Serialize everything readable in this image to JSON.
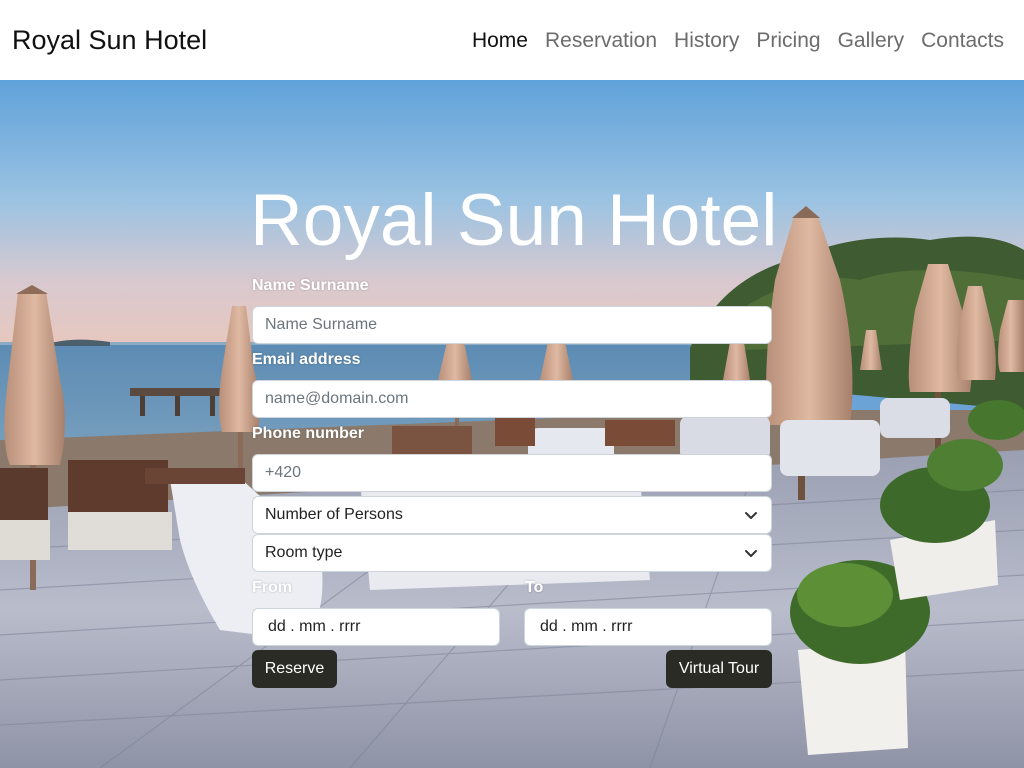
{
  "navbar": {
    "brand": "Royal Sun Hotel",
    "links": [
      "Home",
      "Reservation",
      "History",
      "Pricing",
      "Gallery",
      "Contacts"
    ],
    "active": "Home"
  },
  "hero": {
    "title": "Royal Sun Hotel",
    "background": "beach-terrace-photo"
  },
  "form": {
    "name_label": "Name Surname",
    "name_placeholder": "Name Surname",
    "email_label": "Email address",
    "email_placeholder": "name@domain.com",
    "phone_label": "Phone number",
    "phone_placeholder": "+420",
    "persons_select": "Number of Persons",
    "room_select": "Room type",
    "from_label": "From",
    "to_label": "To",
    "from_value": "dd . mm . rrrr",
    "to_value": "dd . mm . rrrr",
    "reserve_button": "Reserve",
    "tour_button": "Virtual Tour"
  },
  "colors": {
    "button_bg": "#2a2b25",
    "nav_active": "#111111",
    "nav_inactive": "#6c6c6c"
  }
}
